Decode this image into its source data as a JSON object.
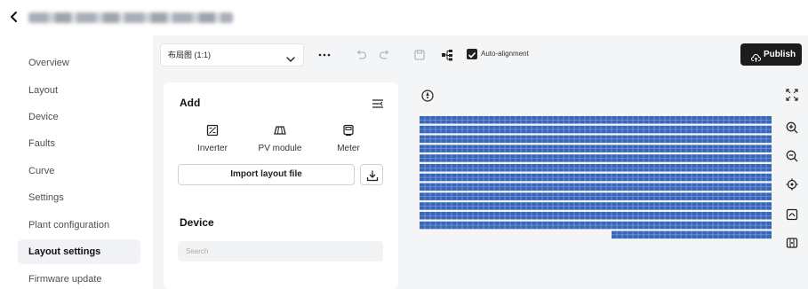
{
  "header": {
    "back_icon": "chevron-left-icon",
    "blurred_title": "▓▓▓▓▓▓▓▓▓▓▓"
  },
  "sidebar": {
    "items": [
      {
        "label": "Overview",
        "active": false
      },
      {
        "label": "Layout",
        "active": false
      },
      {
        "label": "Device",
        "active": false
      },
      {
        "label": "Faults",
        "active": false
      },
      {
        "label": "Curve",
        "active": false
      },
      {
        "label": "Settings",
        "active": false
      },
      {
        "label": "Plant configuration",
        "active": false
      },
      {
        "label": "Layout settings",
        "active": true
      },
      {
        "label": "Firmware update",
        "active": false
      }
    ]
  },
  "toolbar": {
    "layout_select_value": "布局图 (1:1)",
    "more_icon": "more-horizontal-icon",
    "undo_icon": "undo-icon",
    "redo_icon": "redo-icon",
    "save_icon": "save-icon",
    "tree_icon": "hierarchy-icon",
    "auto_alignment_label": "Auto-alignment",
    "auto_alignment_checked": true,
    "publish_label": "Publish",
    "publish_icon": "upload-cloud-icon"
  },
  "panel": {
    "add_title": "Add",
    "collapse_icon": "collapse-list-icon",
    "add_items": [
      {
        "label": "Inverter",
        "icon": "inverter-icon"
      },
      {
        "label": "PV module",
        "icon": "pv-module-icon"
      },
      {
        "label": "Meter",
        "icon": "meter-icon"
      }
    ],
    "import_label": "Import layout file",
    "download_icon": "download-icon",
    "device_title": "Device",
    "search_placeholder": "Search"
  },
  "canvas": {
    "compass_icon": "compass-icon",
    "panel_color": "#3a66b8",
    "right_tools": [
      {
        "icon": "fullscreen-icon"
      },
      {
        "icon": "zoom-in-icon"
      },
      {
        "icon": "zoom-out-icon"
      },
      {
        "icon": "locate-icon"
      },
      {
        "icon": "fit-view-icon"
      },
      {
        "icon": "layers-icon"
      }
    ]
  },
  "colors": {
    "publish_bg": "#1c1c1c",
    "main_bg": "#f4f5f7",
    "active_item_bg": "#f0f2f5"
  }
}
